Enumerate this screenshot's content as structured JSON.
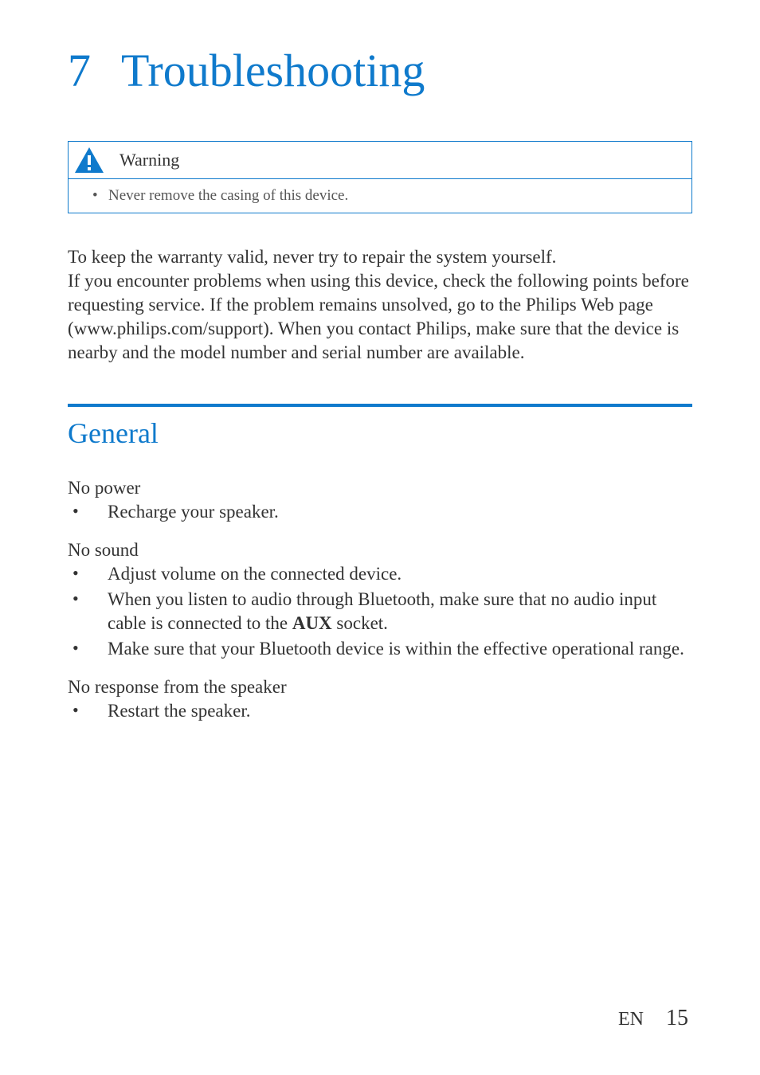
{
  "chapter": {
    "number": "7",
    "title": "Troubleshooting"
  },
  "warning": {
    "label": "Warning",
    "items": [
      "Never remove the casing of this device."
    ]
  },
  "intro": "To keep the warranty valid, never try to repair the system yourself.\nIf you encounter problems when using this device, check the following points before requesting service. If the problem remains unsolved, go to the Philips Web page (www.philips.com/support). When you contact Philips, make sure that the device is nearby and the model number and serial number are available.",
  "section": {
    "title": "General",
    "issues": [
      {
        "title": "No power",
        "items": [
          {
            "pre": "Recharge your speaker.",
            "bold": "",
            "post": ""
          }
        ]
      },
      {
        "title": "No sound",
        "items": [
          {
            "pre": "Adjust volume on the connected device.",
            "bold": "",
            "post": ""
          },
          {
            "pre": "When you listen to audio through Bluetooth, make sure that no audio input cable is connected to the ",
            "bold": "AUX",
            "post": " socket."
          },
          {
            "pre": "Make sure that your Bluetooth device is within the effective operational range.",
            "bold": "",
            "post": ""
          }
        ]
      },
      {
        "title": "No response from the speaker",
        "items": [
          {
            "pre": "Restart the speaker.",
            "bold": "",
            "post": ""
          }
        ]
      }
    ]
  },
  "footer": {
    "lang": "EN",
    "page": "15"
  }
}
